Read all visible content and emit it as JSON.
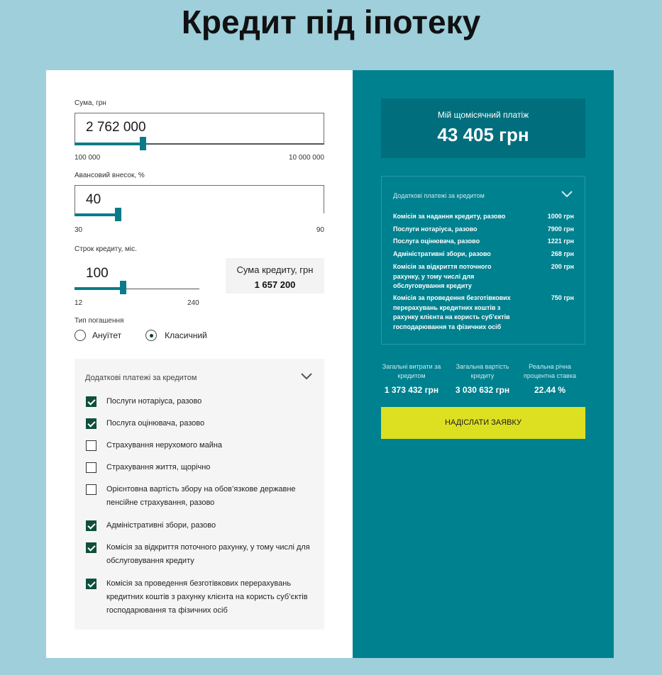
{
  "title": "Кредит під іпотеку",
  "amount": {
    "label": "Сума, грн",
    "value": "2 762 000",
    "min": "100 000",
    "max": "10 000 000",
    "level": 0.27
  },
  "down_payment": {
    "label": "Авансовий внесок, %",
    "value": "40",
    "min": "30",
    "max": "90",
    "level": 0.17
  },
  "term": {
    "label": "Строк кредиту, міс.",
    "value": "100",
    "min": "12",
    "max": "240",
    "level": 0.39
  },
  "loan_sum": {
    "label": "Сума кредиту, грн",
    "value": "1 657 200"
  },
  "repayment": {
    "label": "Тип погашення",
    "options": [
      "Ануїтет",
      "Класичний"
    ],
    "selected": "Класичний"
  },
  "extras": {
    "heading": "Додаткові платежі за кредитом",
    "items": [
      {
        "label": "Послуги нотаріуса, разово",
        "checked": true
      },
      {
        "label": "Послуга оцінювача, разово",
        "checked": true
      },
      {
        "label": "Страхування нерухомого майна",
        "checked": false
      },
      {
        "label": "Страхування життя, щорічно",
        "checked": false
      },
      {
        "label": "Орієнтовна вартість збору на обов’язкове державне пенсійне страхування, разово",
        "checked": false
      },
      {
        "label": "Адміністративні збори, разово",
        "checked": true
      },
      {
        "label": "Комісія за відкриття поточного рахунку, у тому числі для обслуговування кредиту",
        "checked": true
      },
      {
        "label": "Комісія за проведення безготівкових перерахувань кредитних коштів з рахунку клієнта на користь суб’єктів господарювання та фізичних осіб",
        "checked": true
      }
    ]
  },
  "monthly": {
    "label": "Мій щомісячний платіж",
    "value": "43 405 грн"
  },
  "fees": {
    "heading": "Додаткові платежі за кредитом",
    "rows": [
      {
        "name": "Комісія за надання кредиту, разово",
        "amount": "1000 грн"
      },
      {
        "name": "Послуги нотаріуса, разово",
        "amount": "7900 грн"
      },
      {
        "name": "Послуга оцінювача, разово",
        "amount": "1221 грн"
      },
      {
        "name": "Адміністративні збори, разово",
        "amount": "268 грн"
      },
      {
        "name": "Комісія за відкриття поточного рахунку, у тому числі для обслуговування кредиту",
        "amount": "200 грн"
      },
      {
        "name": "Комісія за проведення безготівкових перерахувань кредитних коштів з рахунку клієнта на користь суб’єктів господарювання та фізичних осіб",
        "amount": "750 грн"
      }
    ]
  },
  "totals": [
    {
      "label": "Загальні витрати за кредитом",
      "value": "1 373 432 грн"
    },
    {
      "label": "Загальна вартість кредиту",
      "value": "3 030 632 грн"
    },
    {
      "label": "Реальна річна процентна ставка",
      "value": "22.44 %"
    }
  ],
  "submit_label": "НАДІСЛАТИ ЗАЯВКУ",
  "colors": {
    "background": "#9ecfdb",
    "panel": "#00818f",
    "accent": "#0a7c89",
    "button": "#dde021",
    "checkbox": "#0f4f3c"
  }
}
